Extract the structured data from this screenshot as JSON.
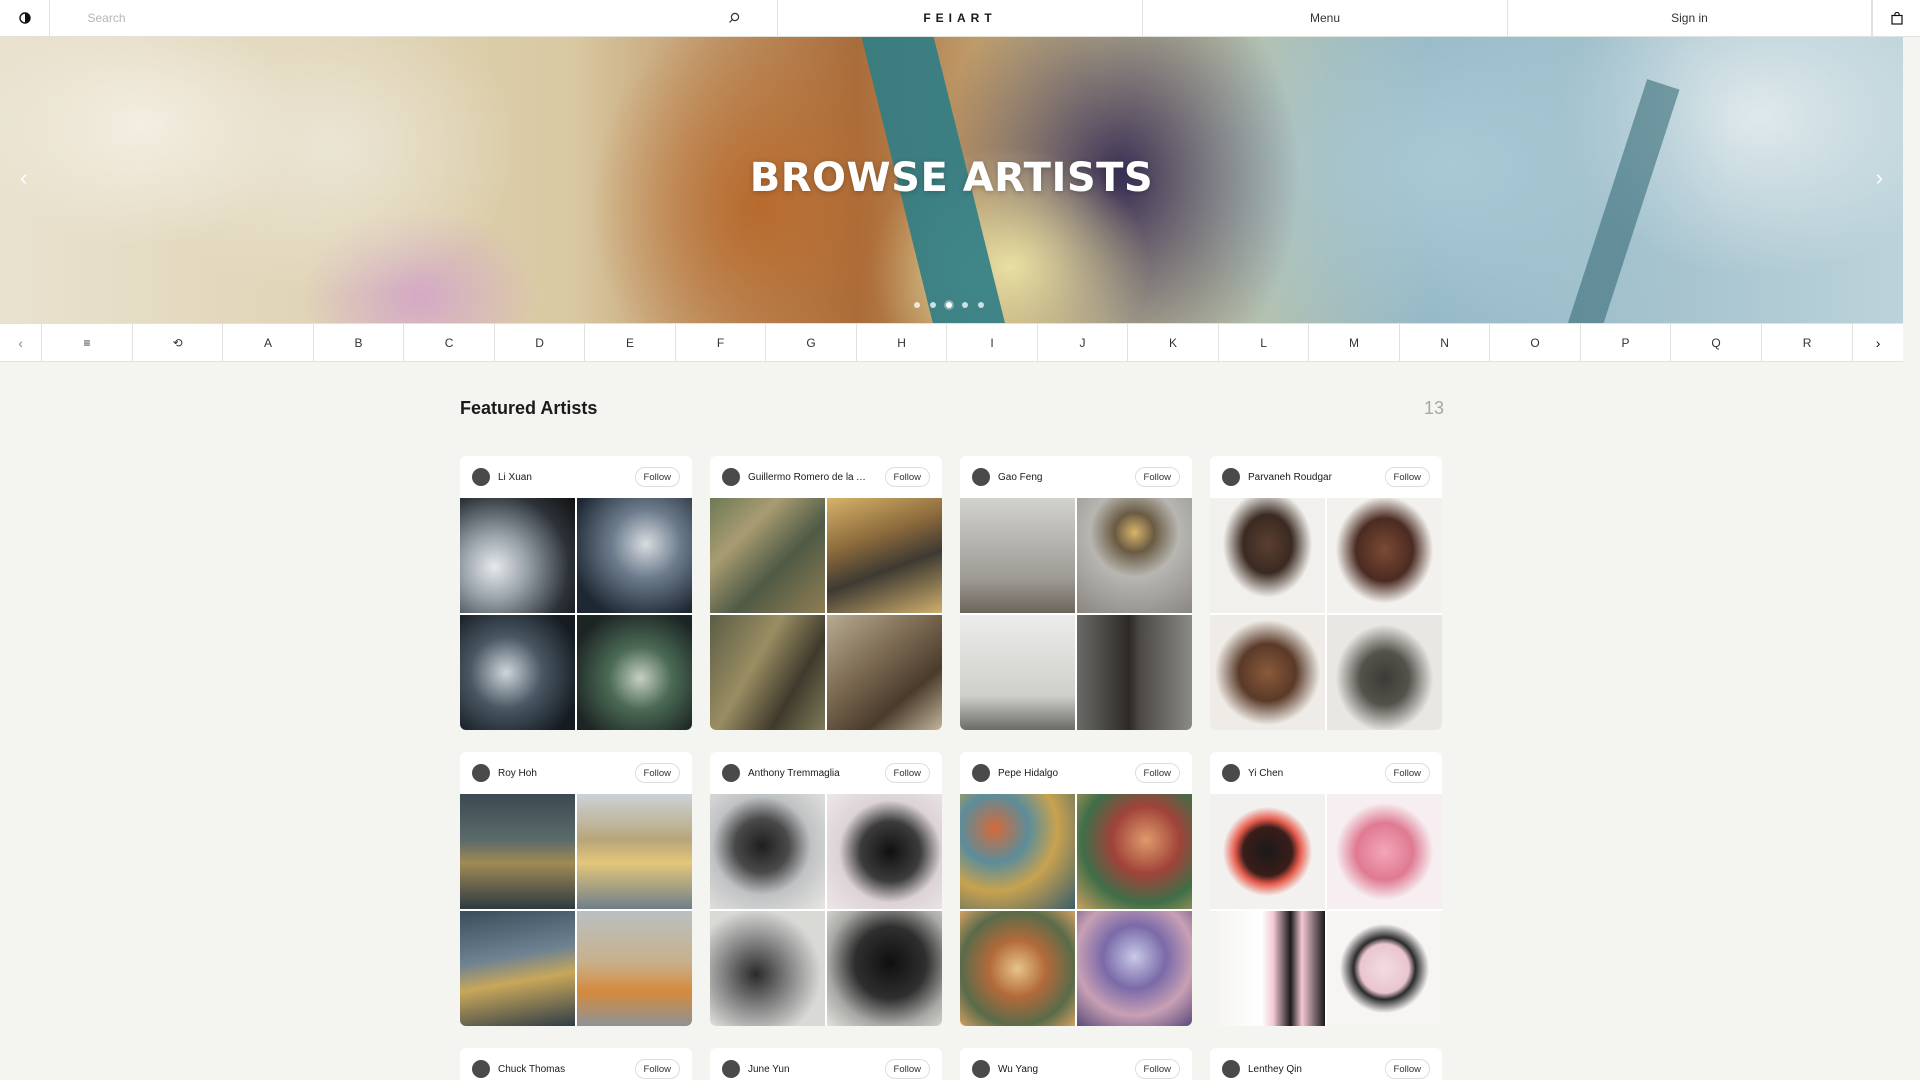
{
  "topbar": {
    "search_placeholder": "Search",
    "brand": "FEIART",
    "menu": "Menu",
    "signin": "Sign in"
  },
  "hero": {
    "title": "BROWSE ARTISTS",
    "prev": "‹",
    "next": "›",
    "slide_count": 5,
    "active_slide": 2
  },
  "alphabet": {
    "prev": "‹",
    "next": "›",
    "items": [
      "≡",
      "⟲",
      "A",
      "B",
      "C",
      "D",
      "E",
      "F",
      "G",
      "H",
      "I",
      "J",
      "K",
      "L",
      "M",
      "N",
      "O",
      "P",
      "Q",
      "R"
    ]
  },
  "featured": {
    "title": "Featured Artists",
    "count": "13",
    "follow_label": "Follow",
    "artists": [
      {
        "name": "Li Xuan",
        "art": [
          "ink1",
          "ink2",
          "ink3",
          "ink4"
        ]
      },
      {
        "name": "Guillermo Romero de la Ar...",
        "art": [
          "cub1",
          "cub2",
          "cub3",
          "cub4"
        ]
      },
      {
        "name": "Gao Feng",
        "art": [
          "scu1",
          "scu2",
          "scu3",
          "scu4"
        ]
      },
      {
        "name": "Parvaneh Roudgar",
        "art": [
          "brz1",
          "brz2",
          "brz3",
          "brz4"
        ]
      },
      {
        "name": "Roy Hoh",
        "art": [
          "cty1",
          "cty2",
          "cty3",
          "cty4"
        ]
      },
      {
        "name": "Anthony Tremmaglia",
        "art": [
          "knot1",
          "knot2",
          "knot3",
          "knot4"
        ]
      },
      {
        "name": "Pepe Hidalgo",
        "art": [
          "pop1",
          "pop2",
          "pop3",
          "pop4"
        ]
      },
      {
        "name": "Yi Chen",
        "art": [
          "spk1",
          "spk2",
          "spk3",
          "spk4"
        ]
      },
      {
        "name": "Chuck Thomas",
        "art": []
      },
      {
        "name": "June Yun",
        "art": []
      },
      {
        "name": "Wu Yang",
        "art": []
      },
      {
        "name": "Lenthey Qin",
        "art": []
      }
    ]
  },
  "colors": {
    "background": "#f4f4f0",
    "card": "#ffffff",
    "border": "#e2e2dc",
    "muted": "#a7a7a2"
  }
}
